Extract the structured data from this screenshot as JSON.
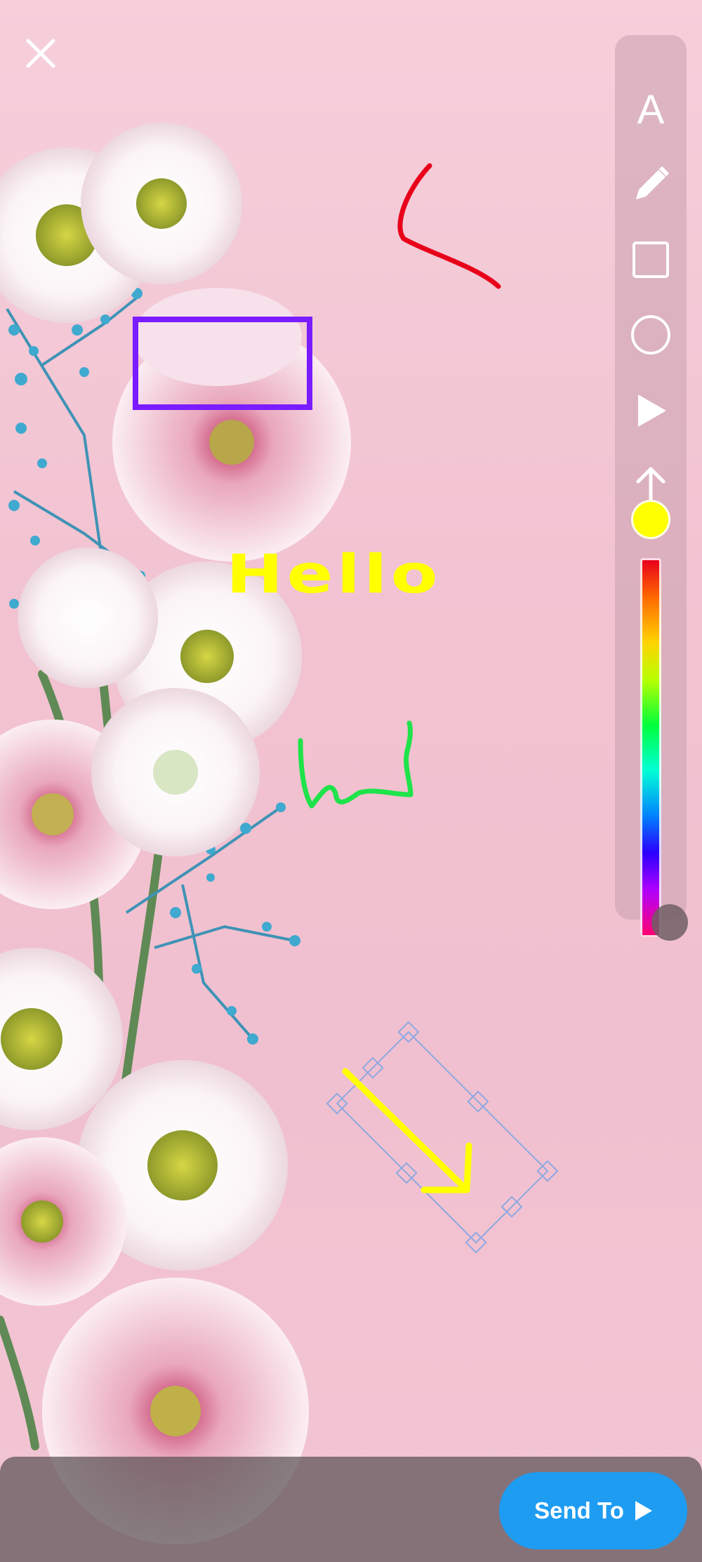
{
  "editor": {
    "hello_text": "Hello",
    "current_color": "#ffff00",
    "annotation_colors": {
      "red_stroke": "#e8001a",
      "purple_rect": "#7a1cff",
      "green_scribble": "#1fe34a",
      "yellow_arrow": "#ffff00",
      "selection": "#8fa8e0"
    }
  },
  "toolbar": {
    "tools": [
      {
        "name": "text-tool",
        "icon": "text-icon",
        "glyph": "A"
      },
      {
        "name": "pen-tool",
        "icon": "pencil-icon"
      },
      {
        "name": "rectangle-tool",
        "icon": "square-icon"
      },
      {
        "name": "ellipse-tool",
        "icon": "circle-icon"
      },
      {
        "name": "triangle-tool",
        "icon": "play-triangle-icon"
      },
      {
        "name": "arrow-tool",
        "icon": "arrow-up-icon"
      }
    ]
  },
  "actions": {
    "close_icon": "close-icon",
    "send_label": "Send To",
    "send_icon": "play-icon",
    "send_color": "#1e9cf2"
  }
}
